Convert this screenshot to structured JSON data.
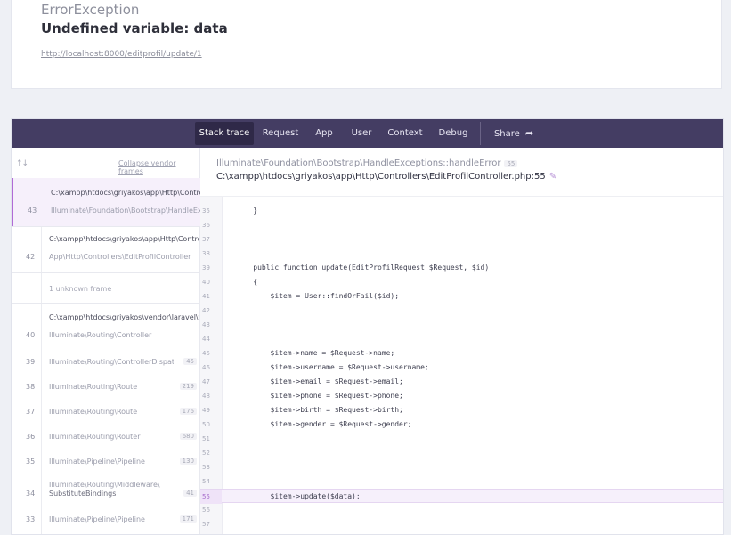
{
  "error": {
    "class": "ErrorException",
    "message": "Undefined variable: data",
    "url": "http://localhost:8000/editprofil/update/1"
  },
  "nav": {
    "tabs": [
      "Stack trace",
      "Request",
      "App",
      "User",
      "Context",
      "Debug"
    ],
    "active_tab": "Stack trace",
    "share_label": "Share",
    "share_icon": "share-arrow-icon"
  },
  "sidebar": {
    "sort_icon": "sort-arrows-icon",
    "collapse_label": "Collapse vendor frames",
    "frames": [
      {
        "number": "43",
        "file": "C:\\xampp\\htdocs\\griyakos\\app\\Http\\Controllers\\EditProfilController.php",
        "class": "Illuminate\\Foundation\\Bootstrap\\HandleExceptions",
        "line": ""
      },
      {
        "number": "42",
        "file": "C:\\xampp\\htdocs\\griyakos\\app\\Http\\Controllers\\EditProfilController.php",
        "class": "App\\Http\\Controllers\\EditProfilController",
        "line": ""
      },
      {
        "number": "40",
        "file": "C:\\xampp\\htdocs\\griyakos\\vendor\\laravel\\framework",
        "class": "Illuminate\\Routing\\Controller",
        "line": ""
      },
      {
        "number": "39",
        "file": "",
        "class": "Illuminate\\Routing\\ControllerDispatcher",
        "line": "45"
      },
      {
        "number": "38",
        "file": "",
        "class": "Illuminate\\Routing\\Route",
        "line": "219"
      },
      {
        "number": "37",
        "file": "",
        "class": "Illuminate\\Routing\\Route",
        "line": "176"
      },
      {
        "number": "36",
        "file": "",
        "class": "Illuminate\\Routing\\Router",
        "line": "680"
      },
      {
        "number": "35",
        "file": "",
        "class": "Illuminate\\Pipeline\\Pipeline",
        "line": "130"
      },
      {
        "number": "34",
        "file": "",
        "class": "Illuminate\\Routing\\Middleware\\",
        "class2": "SubstituteBindings",
        "line": "41"
      },
      {
        "number": "33",
        "file": "",
        "class": "Illuminate\\Pipeline\\Pipeline",
        "line": "171"
      }
    ],
    "unknown_label": "1 unknown frame"
  },
  "detail": {
    "class": "Illuminate\\Foundation\\Bootstrap\\HandleExceptions::handleError",
    "class_line": "55",
    "file": "C:\\xampp\\htdocs\\griyakos\\app\\Http\\Controllers\\EditProfilController.php:55",
    "edit_icon": "pencil-icon"
  },
  "code": {
    "highlight_line": "55",
    "lines": [
      {
        "n": "35",
        "t": "    }"
      },
      {
        "n": "36",
        "t": ""
      },
      {
        "n": "37",
        "t": ""
      },
      {
        "n": "38",
        "t": ""
      },
      {
        "n": "39",
        "t": "    public function update(EditProfilRequest $Request, $id)"
      },
      {
        "n": "40",
        "t": "    {"
      },
      {
        "n": "41",
        "t": "        $item = User::findOrFail($id);"
      },
      {
        "n": "42",
        "t": ""
      },
      {
        "n": "43",
        "t": ""
      },
      {
        "n": "44",
        "t": ""
      },
      {
        "n": "45",
        "t": "        $item->name = $Request->name;"
      },
      {
        "n": "46",
        "t": "        $item->username = $Request->username;"
      },
      {
        "n": "47",
        "t": "        $item->email = $Request->email;"
      },
      {
        "n": "48",
        "t": "        $item->phone = $Request->phone;"
      },
      {
        "n": "49",
        "t": "        $item->birth = $Request->birth;"
      },
      {
        "n": "50",
        "t": "        $item->gender = $Request->gender;"
      },
      {
        "n": "51",
        "t": ""
      },
      {
        "n": "52",
        "t": ""
      },
      {
        "n": "53",
        "t": ""
      },
      {
        "n": "54",
        "t": ""
      },
      {
        "n": "55",
        "t": "        $item->update($data);"
      },
      {
        "n": "56",
        "t": ""
      },
      {
        "n": "57",
        "t": ""
      }
    ]
  }
}
